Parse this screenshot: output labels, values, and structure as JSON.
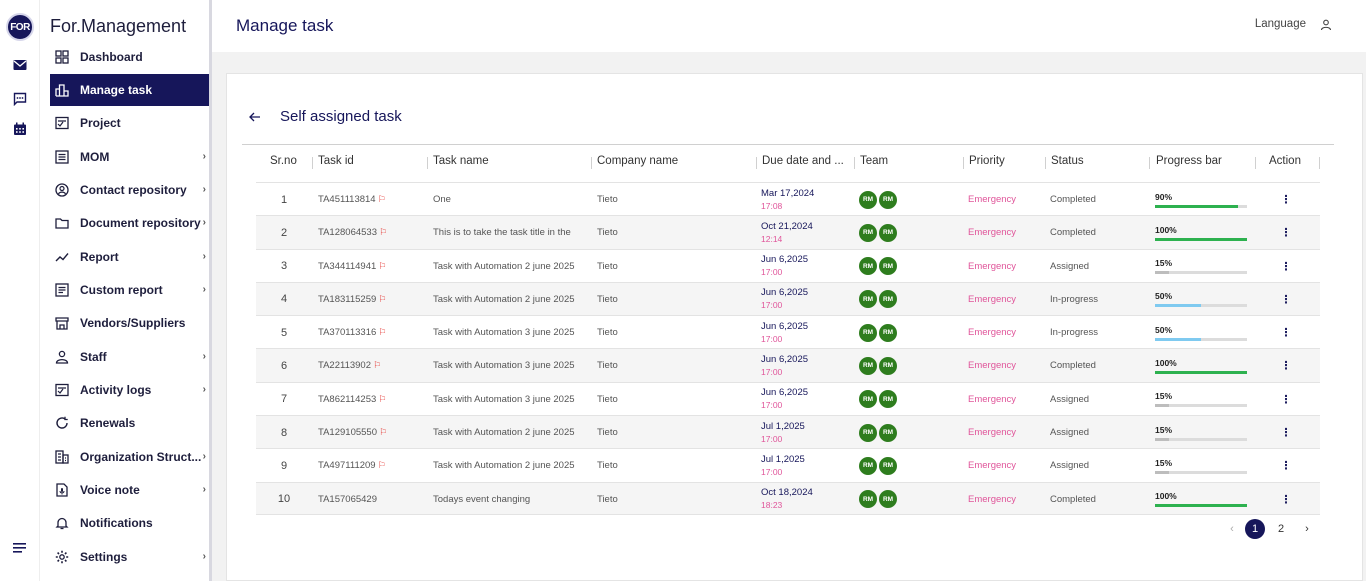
{
  "app": {
    "logo_text": "FOR",
    "brand": "For.Management"
  },
  "topbar": {
    "title": "Manage task",
    "language_label": "Language"
  },
  "sidebar": {
    "items": [
      {
        "label": "Dashboard",
        "icon": "dashboard-icon",
        "has_submenu": false,
        "active": false
      },
      {
        "label": "Manage task",
        "icon": "bar-chart-icon",
        "has_submenu": false,
        "active": true
      },
      {
        "label": "Project",
        "icon": "project-icon",
        "has_submenu": false,
        "active": false
      },
      {
        "label": "MOM",
        "icon": "list-icon",
        "has_submenu": true,
        "active": false
      },
      {
        "label": "Contact repository",
        "icon": "contact-icon",
        "has_submenu": true,
        "active": false
      },
      {
        "label": "Document repository",
        "icon": "folder-icon",
        "has_submenu": true,
        "active": false
      },
      {
        "label": "Report",
        "icon": "trend-icon",
        "has_submenu": true,
        "active": false
      },
      {
        "label": "Custom report",
        "icon": "report-icon",
        "has_submenu": true,
        "active": false
      },
      {
        "label": "Vendors/Suppliers",
        "icon": "store-icon",
        "has_submenu": false,
        "active": false
      },
      {
        "label": "Staff",
        "icon": "person-icon",
        "has_submenu": true,
        "active": false
      },
      {
        "label": "Activity logs",
        "icon": "activity-icon",
        "has_submenu": true,
        "active": false
      },
      {
        "label": "Renewals",
        "icon": "renew-icon",
        "has_submenu": false,
        "active": false
      },
      {
        "label": "Organization Struct...",
        "icon": "building-icon",
        "has_submenu": true,
        "active": false
      },
      {
        "label": "Voice note",
        "icon": "voice-note-icon",
        "has_submenu": true,
        "active": false
      },
      {
        "label": "Notifications",
        "icon": "bell-icon",
        "has_submenu": false,
        "active": false
      },
      {
        "label": "Settings",
        "icon": "gear-icon",
        "has_submenu": true,
        "active": false
      }
    ]
  },
  "card": {
    "title": "Self assigned task"
  },
  "table": {
    "headers": [
      "Sr.no",
      "Task id",
      "Task name",
      "Company name",
      "Due date and ...",
      "Team",
      "Priority",
      "Status",
      "Progress bar",
      "Action"
    ],
    "rows": [
      {
        "sr": "1",
        "task_id": "TA451113814",
        "flag": true,
        "name": "One",
        "company": "Tieto",
        "due_date": "Mar 17,2024",
        "due_time": "17:08",
        "team": [
          "RM",
          "RM"
        ],
        "priority": "Emergency",
        "status": "Completed",
        "progress": 90,
        "progress_label": "90%"
      },
      {
        "sr": "2",
        "task_id": "TA128064533",
        "flag": true,
        "name": "This is to take the task title in the",
        "company": "Tieto",
        "due_date": "Oct 21,2024",
        "due_time": "12:14",
        "team": [
          "RM",
          "RM"
        ],
        "priority": "Emergency",
        "status": "Completed",
        "progress": 100,
        "progress_label": "100%"
      },
      {
        "sr": "3",
        "task_id": "TA344114941",
        "flag": true,
        "name": "Task with Automation 2 june 2025",
        "company": "Tieto",
        "due_date": "Jun 6,2025",
        "due_time": "17:00",
        "team": [
          "RM",
          "RM"
        ],
        "priority": "Emergency",
        "status": "Assigned",
        "progress": 15,
        "progress_label": "15%"
      },
      {
        "sr": "4",
        "task_id": "TA183115259",
        "flag": true,
        "name": "Task with Automation 2 june 2025",
        "company": "Tieto",
        "due_date": "Jun 6,2025",
        "due_time": "17:00",
        "team": [
          "RM",
          "RM"
        ],
        "priority": "Emergency",
        "status": "In-progress",
        "progress": 50,
        "progress_label": "50%"
      },
      {
        "sr": "5",
        "task_id": "TA370113316",
        "flag": true,
        "name": "Task with Automation 3 june 2025",
        "company": "Tieto",
        "due_date": "Jun 6,2025",
        "due_time": "17:00",
        "team": [
          "RM",
          "RM"
        ],
        "priority": "Emergency",
        "status": "In-progress",
        "progress": 50,
        "progress_label": "50%"
      },
      {
        "sr": "6",
        "task_id": "TA22113902",
        "flag": true,
        "name": "Task with Automation 3 june 2025",
        "company": "Tieto",
        "due_date": "Jun 6,2025",
        "due_time": "17:00",
        "team": [
          "RM",
          "RM"
        ],
        "priority": "Emergency",
        "status": "Completed",
        "progress": 100,
        "progress_label": "100%"
      },
      {
        "sr": "7",
        "task_id": "TA862114253",
        "flag": true,
        "name": "Task with Automation 3 june 2025",
        "company": "Tieto",
        "due_date": "Jun 6,2025",
        "due_time": "17:00",
        "team": [
          "RM",
          "RM"
        ],
        "priority": "Emergency",
        "status": "Assigned",
        "progress": 15,
        "progress_label": "15%"
      },
      {
        "sr": "8",
        "task_id": "TA129105550",
        "flag": true,
        "name": "Task with Automation 2 june 2025",
        "company": "Tieto",
        "due_date": "Jul 1,2025",
        "due_time": "17:00",
        "team": [
          "RM",
          "RM"
        ],
        "priority": "Emergency",
        "status": "Assigned",
        "progress": 15,
        "progress_label": "15%"
      },
      {
        "sr": "9",
        "task_id": "TA497111209",
        "flag": true,
        "name": "Task with Automation 2 june 2025",
        "company": "Tieto",
        "due_date": "Jul 1,2025",
        "due_time": "17:00",
        "team": [
          "RM",
          "RM"
        ],
        "priority": "Emergency",
        "status": "Assigned",
        "progress": 15,
        "progress_label": "15%"
      },
      {
        "sr": "10",
        "task_id": "TA157065429",
        "flag": false,
        "name": "Todays event changing",
        "company": "Tieto",
        "due_date": "Oct 18,2024",
        "due_time": "18:23",
        "team": [
          "RM",
          "RM"
        ],
        "priority": "Emergency",
        "status": "Completed",
        "progress": 100,
        "progress_label": "100%"
      }
    ]
  },
  "pagination": {
    "prev": "‹",
    "pages": [
      "1",
      "2"
    ],
    "current": "1",
    "next": "›"
  },
  "colors": {
    "primary": "#16165a",
    "priority": "#e0559a",
    "progress_complete": "#2db14f",
    "progress_partial": "#7fcaf0",
    "progress_low": "#bdbdbd",
    "avatar": "#2e7d1e"
  }
}
